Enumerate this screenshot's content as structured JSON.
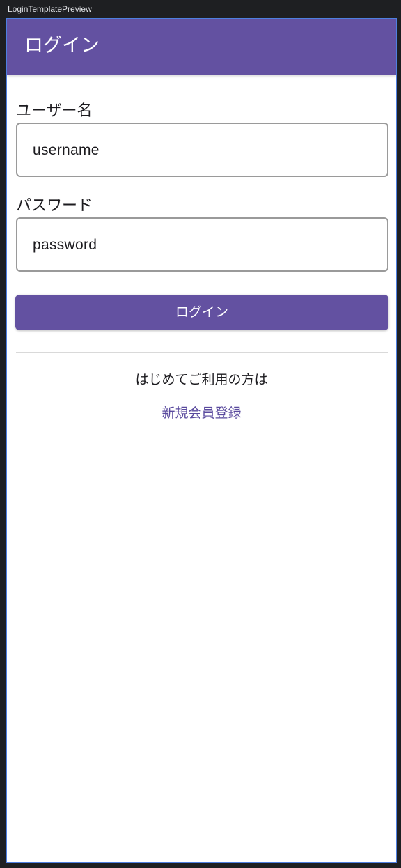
{
  "preview": {
    "label": "LoginTemplatePreview"
  },
  "app_bar": {
    "title": "ログイン",
    "color": "#6351a1"
  },
  "form": {
    "username_label": "ユーザー名",
    "username_value": "username",
    "password_label": "パスワード",
    "password_value": "password",
    "login_button_label": "ログイン",
    "accent_color": "#6351a1"
  },
  "footer": {
    "first_time_text": "はじめてご利用の方は",
    "register_link_label": "新規会員登録",
    "link_color": "#5a4a9e"
  }
}
